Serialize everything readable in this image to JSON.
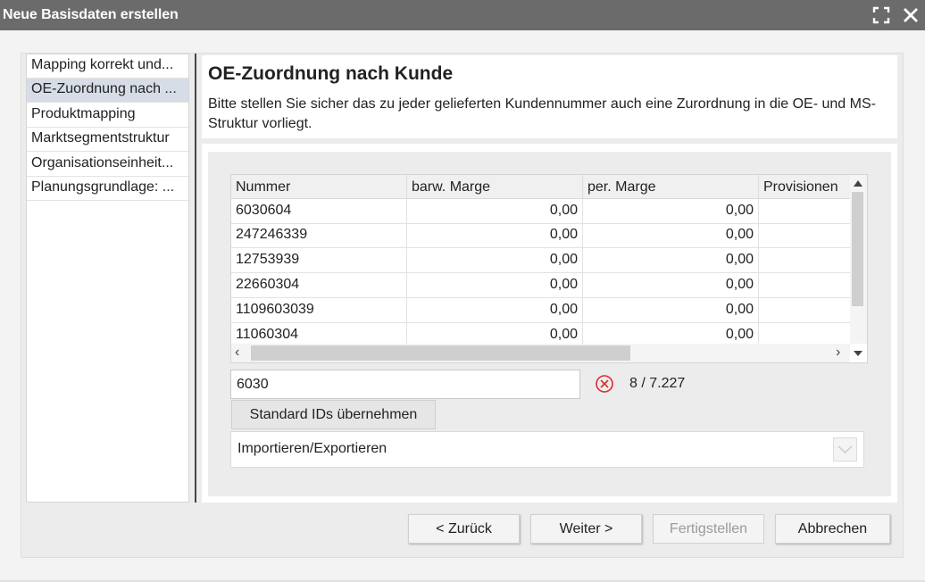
{
  "window": {
    "title": "Neue Basisdaten erstellen",
    "maximize_icon": "maximize-icon",
    "close_icon": "close-icon"
  },
  "nav": {
    "items": [
      {
        "label": "Mapping korrekt und...",
        "selected": false
      },
      {
        "label": "OE-Zuordnung nach ...",
        "selected": true
      },
      {
        "label": "Produktmapping",
        "selected": false
      },
      {
        "label": "Marktsegmentstruktur",
        "selected": false
      },
      {
        "label": "Organisationseinheit...",
        "selected": false
      },
      {
        "label": "Planungsgrundlage: ...",
        "selected": false
      }
    ]
  },
  "header": {
    "title": "OE-Zuordnung nach Kunde",
    "description": "Bitte stellen Sie sicher das zu jeder gelieferten Kundennummer auch eine Zurordnung in die OE- und MS-Struktur vorliegt."
  },
  "table": {
    "columns": [
      "Nummer",
      "barw. Marge",
      "per. Marge",
      "Provisionen"
    ],
    "rows": [
      {
        "nummer": "6030604",
        "barw": "0,00",
        "per": "0,00",
        "prov": ""
      },
      {
        "nummer": "247246339",
        "barw": "0,00",
        "per": "0,00",
        "prov": ""
      },
      {
        "nummer": "12753939",
        "barw": "0,00",
        "per": "0,00",
        "prov": ""
      },
      {
        "nummer": "22660304",
        "barw": "0,00",
        "per": "0,00",
        "prov": ""
      },
      {
        "nummer": "1109603039",
        "barw": "0,00",
        "per": "0,00",
        "prov": ""
      },
      {
        "nummer": "11060304",
        "barw": "0,00",
        "per": "0,00",
        "prov": ""
      }
    ],
    "vertical_scroll_fraction": 0.0,
    "horizontal_scroll_fraction": 0.0
  },
  "filter": {
    "value": "6030",
    "clear_icon": "clear-circle-x-icon",
    "count": "8 / 7.227",
    "accent_color": "#d9302c"
  },
  "buttons": {
    "standard_ids": "Standard IDs übernehmen",
    "back": "< Zurück",
    "next": "Weiter >",
    "finish": "Fertigstellen",
    "cancel": "Abbrechen"
  },
  "import_section": {
    "label": "Importieren/Exportieren",
    "toggle_icon": "chevron-down-icon"
  }
}
